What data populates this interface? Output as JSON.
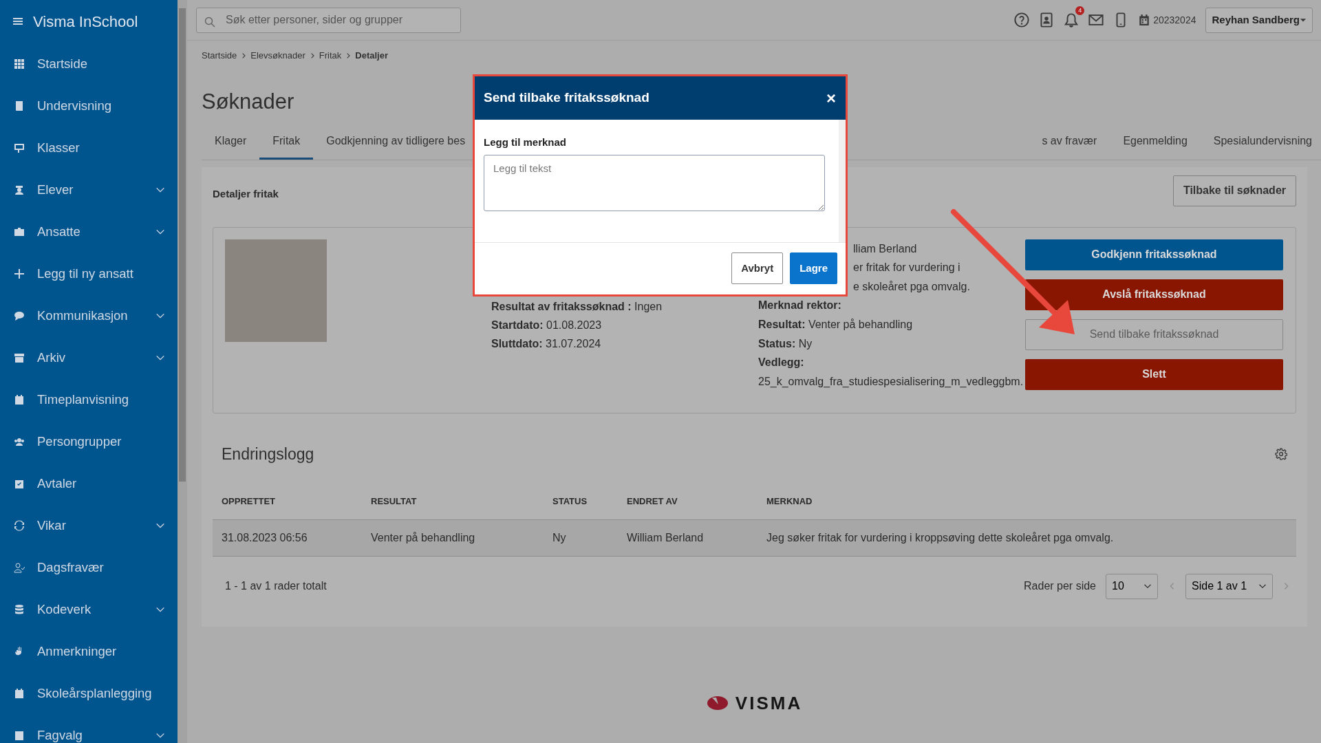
{
  "app": {
    "title": "Visma InSchool"
  },
  "sidebar": {
    "items": [
      {
        "label": "Startside",
        "expandable": false
      },
      {
        "label": "Undervisning",
        "expandable": false
      },
      {
        "label": "Klasser",
        "expandable": false
      },
      {
        "label": "Elever",
        "expandable": true
      },
      {
        "label": "Ansatte",
        "expandable": true
      },
      {
        "label": "Legg til ny ansatt",
        "expandable": false
      },
      {
        "label": "Kommunikasjon",
        "expandable": true
      },
      {
        "label": "Arkiv",
        "expandable": true
      },
      {
        "label": "Timeplanvisning",
        "expandable": false
      },
      {
        "label": "Persongrupper",
        "expandable": false
      },
      {
        "label": "Avtaler",
        "expandable": false
      },
      {
        "label": "Vikar",
        "expandable": true
      },
      {
        "label": "Dagsfravær",
        "expandable": false
      },
      {
        "label": "Kodeverk",
        "expandable": true
      },
      {
        "label": "Anmerkninger",
        "expandable": false
      },
      {
        "label": "Skoleårsplanlegging",
        "expandable": false
      },
      {
        "label": "Fagvalg",
        "expandable": true
      }
    ]
  },
  "search": {
    "placeholder": "Søk etter personer, sider og grupper"
  },
  "header": {
    "notification_count": "4",
    "school_year": "20232024",
    "user": "Reyhan Sandberg"
  },
  "breadcrumb": [
    {
      "label": "Startside",
      "current": false
    },
    {
      "label": "Elevsøknader",
      "current": false
    },
    {
      "label": "Fritak",
      "current": false
    },
    {
      "label": "Detaljer",
      "current": true
    }
  ],
  "page_title": "Søknader",
  "tabs": [
    {
      "label": "Klager",
      "selected": false
    },
    {
      "label": "Fritak",
      "selected": true
    },
    {
      "label": "Godkjenning av tidligere bes",
      "selected": false
    },
    {
      "label": "s av fravær",
      "selected": false
    },
    {
      "label": "Egenmelding",
      "selected": false
    },
    {
      "label": "Spesialundervisning",
      "selected": false
    }
  ],
  "details": {
    "title": "Detaljer fritak",
    "back_button": "Tilbake til søknader",
    "left_fields": [
      {
        "label": "Resultat av fritakssøknad :",
        "value": "Ingen"
      },
      {
        "label": "Startdato:",
        "value": "01.08.2023"
      },
      {
        "label": "Sluttdato:",
        "value": "31.07.2024"
      }
    ],
    "right_lines": [
      {
        "kind": "partial",
        "text": "lliam Berland"
      },
      {
        "kind": "partial",
        "text": "er fritak for vurdering i"
      },
      {
        "kind": "partial",
        "text": "e skoleåret pga omvalg."
      },
      {
        "kind": "field",
        "label": "Merknad rektor:"
      },
      {
        "kind": "field",
        "label": "Resultat:",
        "value": "Venter på behandling"
      },
      {
        "kind": "field",
        "label": "Status:",
        "value": "Ny"
      },
      {
        "kind": "field",
        "label": "Vedlegg:"
      },
      {
        "kind": "text",
        "text": "25_k_omvalg_fra_studiespesialisering_m_vedleggbm."
      }
    ],
    "actions": [
      {
        "label": "Godkjenn fritakssøknad",
        "kind": "primary"
      },
      {
        "label": "Avslå fritakssøknad",
        "kind": "danger"
      },
      {
        "label": "Send tilbake fritakssøknad",
        "kind": "outline"
      },
      {
        "label": "Slett",
        "kind": "danger"
      }
    ]
  },
  "log": {
    "title": "Endringslogg",
    "columns": [
      "OPPRETTET",
      "RESULTAT",
      "STATUS",
      "ENDRET AV",
      "MERKNAD"
    ],
    "rows": [
      [
        "31.08.2023 06:56",
        "Venter på behandling",
        "Ny",
        "William Berland",
        "Jeg søker fritak for vurdering i kroppsøving dette skoleåret pga omvalg."
      ]
    ],
    "summary": "1 - 1 av 1 rader totalt",
    "rows_per_page_label": "Rader per side",
    "rows_per_page": "10",
    "page": "Side 1 av 1"
  },
  "footer": {
    "logo": "VISMA"
  },
  "modal": {
    "title": "Send tilbake fritakssøknad",
    "close": "×",
    "field_label": "Legg til merknad",
    "placeholder": "Legg til tekst",
    "buttons": [
      {
        "label": "Avbryt",
        "kind": "secondary"
      },
      {
        "label": "Lagre",
        "kind": "primary"
      }
    ]
  }
}
